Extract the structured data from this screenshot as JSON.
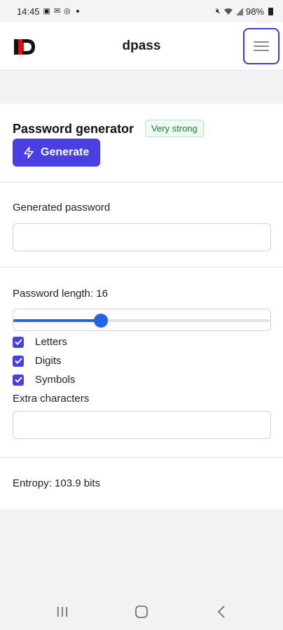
{
  "status_bar": {
    "time": "14:45",
    "battery": "98%"
  },
  "header": {
    "title": "dpass",
    "menu_icon": "hamburger-icon"
  },
  "generator": {
    "title": "Password generator",
    "strength_badge": "Very strong",
    "generate_label": "Generate"
  },
  "generated_password": {
    "label": "Generated password",
    "value": ""
  },
  "options": {
    "length_label": "Password length: 16",
    "length_fraction": 0.34,
    "checkboxes": [
      {
        "label": "Letters",
        "checked": true
      },
      {
        "label": "Digits",
        "checked": true
      },
      {
        "label": "Symbols",
        "checked": true
      }
    ],
    "extra_label": "Extra characters",
    "extra_value": ""
  },
  "entropy": {
    "text": "Entropy: 103.9 bits"
  },
  "colors": {
    "accent": "#4a3fe0",
    "slider": "#2563eb",
    "badge_green": "#1f7a3a"
  }
}
